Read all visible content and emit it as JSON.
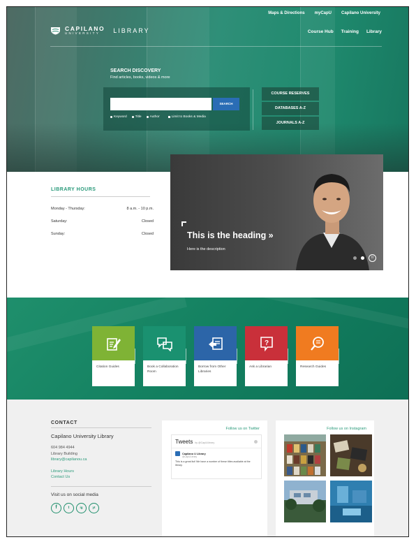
{
  "top_links": [
    "Maps & Directions",
    "myCapU",
    "Capilano University"
  ],
  "logo": {
    "wordmark": "CAPILANO",
    "subtitle": "UNIVERSITY",
    "library": "LIBRARY"
  },
  "main_nav": [
    "Course Hub",
    "Training",
    "Library"
  ],
  "search": {
    "title": "SEARCH DISCOVERY",
    "subtitle": "Find articles, books, videos & more",
    "placeholder": "",
    "button": "SEARCH",
    "options": [
      "Keyword",
      "Title",
      "Author",
      "Limit to Books & Media"
    ]
  },
  "quick_links": [
    "COURSE RESERVES",
    "DATABASES A-Z",
    "JOURNALS A-Z"
  ],
  "slide": {
    "heading": "This is the heading »",
    "description": "Here is the description",
    "pause": "II"
  },
  "hours": {
    "title": "LIBRARY HOURS",
    "rows": [
      {
        "day": "Monday - Thursday:",
        "time": "8 a.m. - 10 p.m."
      },
      {
        "day": "Saturday:",
        "time": "Closed"
      },
      {
        "day": "Sunday:",
        "time": "Closed"
      }
    ]
  },
  "tiles": [
    {
      "label": "Citation Guides",
      "color": "#7fb335",
      "icon": "edit-icon"
    },
    {
      "label": "Book a Collaboration Room",
      "color": "#1a9170",
      "icon": "chat-bubbles-icon"
    },
    {
      "label": "Borrow from Other Libraries",
      "color": "#2c65a8",
      "icon": "exchange-icon"
    },
    {
      "label": "Ask a Librarian",
      "color": "#c9303a",
      "icon": "question-icon"
    },
    {
      "label": "Research Guides",
      "color": "#f07b20",
      "icon": "magnifier-icon"
    }
  ],
  "contact": {
    "title": "CONTACT",
    "name": "Capilano University Library",
    "phone": "604 984 4944",
    "building": "Library Building",
    "email": "library@capilanou.ca",
    "links": [
      "Library Hours",
      "Contact Us"
    ],
    "social_title": "Visit us on social media",
    "social": [
      "f",
      "t",
      "ig",
      "yt"
    ]
  },
  "twitter": {
    "follow": "Follow us on Twitter",
    "title": "Tweets",
    "by": "by @CapULibrary",
    "account": "Capilano U Library",
    "handle": "@CapULibrary",
    "text": "This is a great list! We have a number of these titles available at the library."
  },
  "instagram": {
    "follow": "Follow us on Instagram"
  },
  "colors": {
    "brand_green": "#1f8f6c",
    "link_green": "#2a9a7a",
    "search_blue": "#2a6db5"
  }
}
